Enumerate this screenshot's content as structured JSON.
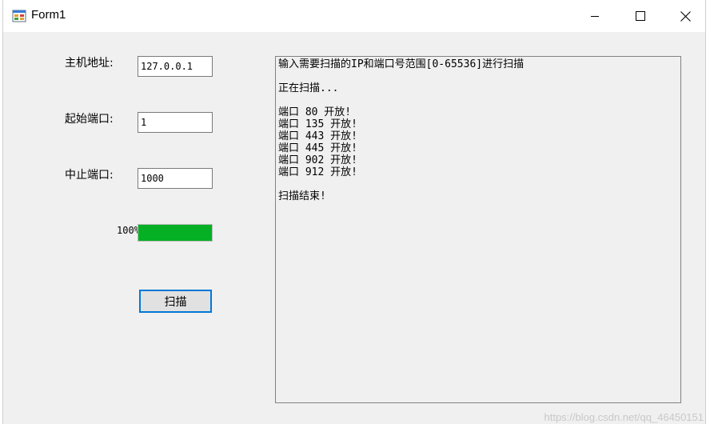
{
  "window": {
    "title": "Form1"
  },
  "form": {
    "host_label": "主机地址:",
    "host_value": "127.0.0.1",
    "start_port_label": "起始端口:",
    "start_port_value": "1",
    "end_port_label": "中止端口:",
    "end_port_value": "1000",
    "progress_text": "100%",
    "progress": 1.0,
    "scan_button": "扫描"
  },
  "output": {
    "intro": "输入需要扫描的IP和端口号范围[0-65536]进行扫描",
    "scanning": "正在扫描...",
    "ports": [
      "端口 80 开放!",
      "端口 135 开放!",
      "端口 443 开放!",
      "端口 445 开放!",
      "端口 902 开放!",
      "端口 912 开放!"
    ],
    "done": "扫描结束!"
  },
  "watermark": "https://blog.csdn.net/qq_46450151",
  "colors": {
    "progress": "#06b025",
    "button_border": "#0078d7"
  }
}
